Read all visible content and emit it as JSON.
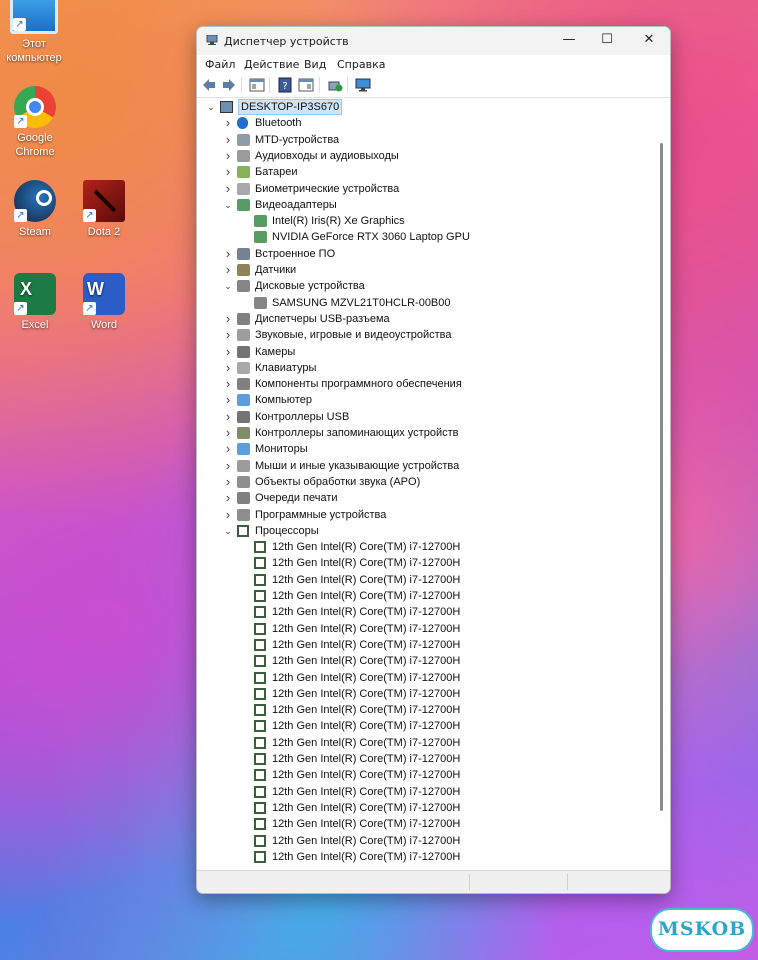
{
  "desktop": {
    "icons": [
      {
        "label": "Этот компьютер",
        "icon": "this-pc-icon"
      },
      {
        "label": "Google Chrome",
        "icon": "chrome-icon"
      },
      {
        "label": "Steam",
        "icon": "steam-icon"
      },
      {
        "label": "Dota 2",
        "icon": "dota2-icon"
      },
      {
        "label": "Excel",
        "icon": "excel-icon"
      },
      {
        "label": "Word",
        "icon": "word-icon"
      }
    ],
    "watermark": "MSKOB"
  },
  "window": {
    "title": "Диспетчер устройств",
    "controls": {
      "minimize": "—",
      "maximize": "☐",
      "close": "✕"
    },
    "menu": [
      "Файл",
      "Действие",
      "Вид",
      "Справка"
    ],
    "toolbar": [
      "back-icon",
      "forward-icon",
      "properties-icon",
      "help-icon",
      "show-hidden-icon",
      "update-driver-icon",
      "scan-hardware-icon"
    ],
    "tree": {
      "root": "DESKTOP-IP3S670",
      "categories": [
        {
          "label": "Bluetooth",
          "icon": "bluetooth-icon",
          "expanded": false
        },
        {
          "label": "MTD-устройства",
          "icon": "mtd-icon",
          "expanded": false
        },
        {
          "label": "Аудиовходы и аудиовыходы",
          "icon": "audio-io-icon",
          "expanded": false
        },
        {
          "label": "Батареи",
          "icon": "battery-icon",
          "expanded": false
        },
        {
          "label": "Биометрические устройства",
          "icon": "biometric-icon",
          "expanded": false
        },
        {
          "label": "Видеоадаптеры",
          "icon": "display-adapter-icon",
          "expanded": true,
          "children": [
            "Intel(R) Iris(R) Xe Graphics",
            "NVIDIA GeForce RTX 3060 Laptop GPU"
          ]
        },
        {
          "label": "Встроенное ПО",
          "icon": "firmware-icon",
          "expanded": false
        },
        {
          "label": "Датчики",
          "icon": "sensor-icon",
          "expanded": false
        },
        {
          "label": "Дисковые устройства",
          "icon": "disk-drive-icon",
          "expanded": true,
          "children": [
            "SAMSUNG MZVL21T0HCLR-00B00"
          ]
        },
        {
          "label": "Диспетчеры USB-разъема",
          "icon": "usb-connector-icon",
          "expanded": false
        },
        {
          "label": "Звуковые, игровые и видеоустройства",
          "icon": "sound-icon",
          "expanded": false
        },
        {
          "label": "Камеры",
          "icon": "camera-icon",
          "expanded": false
        },
        {
          "label": "Клавиатуры",
          "icon": "keyboard-icon",
          "expanded": false
        },
        {
          "label": "Компоненты программного обеспечения",
          "icon": "software-component-icon",
          "expanded": false
        },
        {
          "label": "Компьютер",
          "icon": "computer-icon",
          "expanded": false
        },
        {
          "label": "Контроллеры USB",
          "icon": "usb-controller-icon",
          "expanded": false
        },
        {
          "label": "Контроллеры запоминающих устройств",
          "icon": "storage-controller-icon",
          "expanded": false
        },
        {
          "label": "Мониторы",
          "icon": "monitor-icon",
          "expanded": false
        },
        {
          "label": "Мыши и иные указывающие устройства",
          "icon": "mouse-icon",
          "expanded": false
        },
        {
          "label": "Объекты обработки звука (APO)",
          "icon": "apo-icon",
          "expanded": false
        },
        {
          "label": "Очереди печати",
          "icon": "print-queue-icon",
          "expanded": false
        },
        {
          "label": "Программные устройства",
          "icon": "software-device-icon",
          "expanded": false
        },
        {
          "label": "Процессоры",
          "icon": "processor-icon",
          "expanded": true,
          "children": [
            "12th Gen Intel(R) Core(TM) i7-12700H",
            "12th Gen Intel(R) Core(TM) i7-12700H",
            "12th Gen Intel(R) Core(TM) i7-12700H",
            "12th Gen Intel(R) Core(TM) i7-12700H",
            "12th Gen Intel(R) Core(TM) i7-12700H",
            "12th Gen Intel(R) Core(TM) i7-12700H",
            "12th Gen Intel(R) Core(TM) i7-12700H",
            "12th Gen Intel(R) Core(TM) i7-12700H",
            "12th Gen Intel(R) Core(TM) i7-12700H",
            "12th Gen Intel(R) Core(TM) i7-12700H",
            "12th Gen Intel(R) Core(TM) i7-12700H",
            "12th Gen Intel(R) Core(TM) i7-12700H",
            "12th Gen Intel(R) Core(TM) i7-12700H",
            "12th Gen Intel(R) Core(TM) i7-12700H",
            "12th Gen Intel(R) Core(TM) i7-12700H",
            "12th Gen Intel(R) Core(TM) i7-12700H",
            "12th Gen Intel(R) Core(TM) i7-12700H",
            "12th Gen Intel(R) Core(TM) i7-12700H",
            "12th Gen Intel(R) Core(TM) i7-12700H",
            "12th Gen Intel(R) Core(TM) i7-12700H"
          ]
        }
      ]
    }
  }
}
